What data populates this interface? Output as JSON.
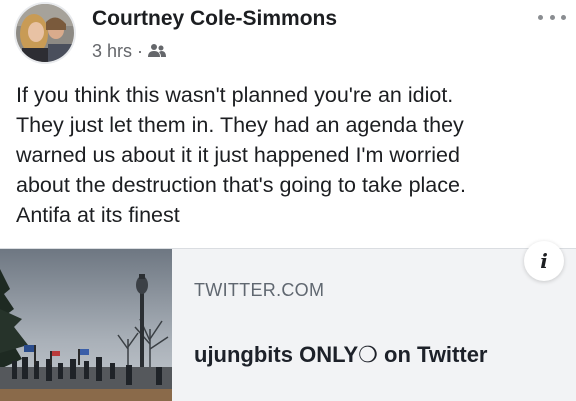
{
  "post": {
    "author": "Courtney Cole-Simmons",
    "timestamp": "3 hrs",
    "separator": "·",
    "audience_icon": "friends-icon",
    "more_icon": "more-options-icon",
    "text_lines": [
      "If you think this wasn't planned you're an idiot.",
      "They just let them in. They had an agenda they",
      "warned us about it it just happened I'm worried",
      "about the destruction that's going to take place.",
      "Antifa at its finest"
    ]
  },
  "link_card": {
    "domain": "TWITTER.COM",
    "title": "ujungbits ONLY❍ on Twitter",
    "info_label": "i",
    "info_icon": "info-icon"
  },
  "colors": {
    "text": "#1c1e21",
    "secondary_text": "#65676b",
    "card_background": "#f2f3f5"
  }
}
